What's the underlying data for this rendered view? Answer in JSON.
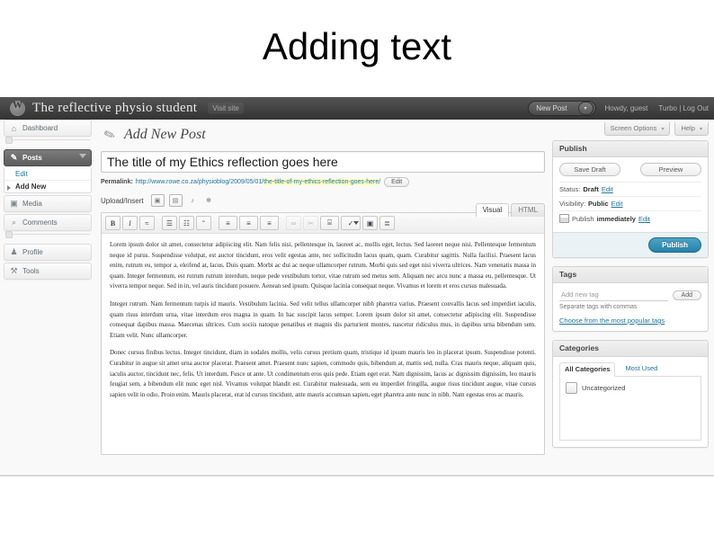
{
  "slide": {
    "title": "Adding text"
  },
  "adminbar": {
    "site_name": "The reflective physio student",
    "visit_site": "Visit site",
    "new_post": "New Post",
    "howdy": "Howdy, guest",
    "links": "Turbo | Log Out"
  },
  "screen_meta": {
    "screen_options": "Screen Options",
    "help": "Help",
    "caret": "▾"
  },
  "sidebar": {
    "items": [
      {
        "label": "Dashboard",
        "icon": "dashboard-icon",
        "glyph": "⌂"
      },
      {
        "label": "Posts",
        "icon": "pin-icon",
        "glyph": "✎"
      },
      {
        "label": "Media",
        "icon": "camera-icon",
        "glyph": "▣"
      },
      {
        "label": "Comments",
        "icon": "comment-icon",
        "glyph": "⌕"
      },
      {
        "label": "Profile",
        "icon": "user-icon",
        "glyph": "♟"
      },
      {
        "label": "Tools",
        "icon": "tools-icon",
        "glyph": "⚒"
      }
    ],
    "posts_submenu": [
      {
        "label": "Edit",
        "active": false
      },
      {
        "label": "Add New",
        "active": true
      }
    ]
  },
  "page": {
    "title": "Add New Post",
    "icon": "pin-icon"
  },
  "post": {
    "title_value": "The title of my Ethics reflection goes here",
    "permalink_label": "Permalink:",
    "permalink_url": "http://www.rowe.co.za/physioblog/2009/05/01/",
    "permalink_slug": "the-title-of-my-ethics-reflection-goes-here",
    "permalink_tail": "/",
    "edit_slug_button": "Edit"
  },
  "media": {
    "label": "Upload/Insert",
    "buttons": [
      {
        "name": "insert-image-icon",
        "glyph": "▣"
      },
      {
        "name": "insert-video-icon",
        "glyph": "▤"
      },
      {
        "name": "insert-audio-icon",
        "glyph": "♪"
      },
      {
        "name": "insert-media-icon",
        "glyph": "✻"
      }
    ]
  },
  "editor": {
    "tabs": [
      {
        "label": "Visual",
        "active": true
      },
      {
        "label": "HTML",
        "active": false
      }
    ],
    "toolbar": [
      {
        "name": "bold-button",
        "glyph": "B",
        "cls": "bold",
        "disabled": false
      },
      {
        "name": "italic-button",
        "glyph": "I",
        "cls": "ital",
        "disabled": false
      },
      {
        "name": "strikethrough-button",
        "glyph": "≈",
        "cls": "",
        "disabled": false
      },
      {
        "name": "unordered-list-button",
        "glyph": "☰",
        "cls": "",
        "disabled": false
      },
      {
        "name": "ordered-list-button",
        "glyph": "☷",
        "cls": "",
        "disabled": false
      },
      {
        "name": "blockquote-button",
        "glyph": "“",
        "cls": "",
        "disabled": false
      },
      {
        "name": "align-left-button",
        "glyph": "≡",
        "cls": "",
        "disabled": false
      },
      {
        "name": "align-center-button",
        "glyph": "≡",
        "cls": "",
        "disabled": false
      },
      {
        "name": "align-right-button",
        "glyph": "≡",
        "cls": "",
        "disabled": false
      },
      {
        "name": "insert-link-button",
        "glyph": "∞",
        "cls": "",
        "disabled": true
      },
      {
        "name": "remove-link-button",
        "glyph": "✂",
        "cls": "",
        "disabled": true
      },
      {
        "name": "insert-more-button",
        "glyph": "⌸",
        "cls": "",
        "disabled": false
      },
      {
        "name": "spellcheck-button",
        "glyph": "✓",
        "cls": "split",
        "disabled": false
      },
      {
        "name": "fullscreen-button",
        "glyph": "▣",
        "cls": "",
        "disabled": false
      },
      {
        "name": "kitchen-sink-button",
        "glyph": "≣",
        "cls": "",
        "disabled": false
      }
    ],
    "paragraphs": [
      "Lorem ipsum dolor sit amet, consectetur adipiscing elit. Nam felis nisi, pellentesque in, laoreet ac, mollis eget, lectus. Sed laoreet neque nisi. Pellentesque fermentum neque id purus. Suspendisse volutpat, est auctor tincidunt, eros velit egestas ante, nec sollicitudin lacus quam, quam. Curabitur sagittis. Nulla facilisi. Praesent lacus enim, rutrum eu, tempor a, eleifend at, lacus. Duis quam. Morbi ac dui ac neque ullamcorper rutrum. Morbi quis sed eget nisi viverra ultrices. Nam venenatis massa in quam. Integer fermentum, est rutrum rutrum interdum, neque pede vestibulum tortor, vitae rutrum sed metus sem. Aliquam nec arcu nunc a massa eu, pellentesque. Ut viverra tempor neque. Sed in in, vel auris tincidunt posuere. Aenean sed ipsum. Quisque lacinia consequat neque. Vivamus et lorem et eros cursus malesuada.",
      "Integer rutrum. Nam fermentum turpis id mauris. Vestibulum lacinia. Sed velit tellus ullamcorper nibh pharetra varius. Praesent convallis lacus sed imperdiet iaculis, quam risus interdum urna, vitae interdum eros magna in quam. In hac suscipit lacus semper. Lorem ipsum dolor sit amet, consectetur adipiscing elit. Suspendisse consequat dapibus massa. Maecenas ultrices. Cum sociis natoque penatibus et magnis dis parturient montes, nascetur ridiculus mus, in dapibus urna bibendum sem. Etiam velit. Nunc ullamcorper.",
      "Donec cursus finibus lectus. Integer tincidunt, diam in sodales mollis, velis cursus pretium quam, tristique id ipsum mauris leo in placerat ipsum. Suspendisse potenti. Curabitur in augue sit amet urna auctor placerat. Praesent amet. Praesent nunc sapien, commodo quis, bibendum at, mattis sed, nulla. Cras mauris neque, aliquam quis, iaculis auctor, tincidunt nec, felis. Ut interdum. Fusce ut ante. Ut condimentum eros quis pede. Etiam eget erat. Nam dignissim, lacus ac dignissim dignissim, leo mauris feugiat sem, a bibendum elit nunc eget nisl. Vivamus volutpat blandit est. Curabitur malesuada, sem eu imperdiet fringilla, augue risus tincidunt augue, vitae cursus sapien velit in odio. Proin enim. Mauris placerat, erat id cursus tincidunt, ante mauris accumsan sapien, eget pharetra ante nunc in nibh. Nam egestas eros ac mauris."
    ]
  },
  "publish_box": {
    "title": "Publish",
    "save_draft": "Save Draft",
    "preview": "Preview",
    "status_label": "Status:",
    "status_value": "Draft",
    "status_edit": "Edit",
    "visibility_label": "Visibility:",
    "visibility_value": "Public",
    "visibility_edit": "Edit",
    "schedule_label": "Publish",
    "schedule_value": "immediately",
    "schedule_edit": "Edit",
    "publish_button": "Publish"
  },
  "tags_box": {
    "title": "Tags",
    "input_placeholder": "Add new tag",
    "add_button": "Add",
    "hint": "Separate tags with commas",
    "popular_link": "Choose from the most popular tags"
  },
  "categories_box": {
    "title": "Categories",
    "tabs": [
      {
        "label": "All Categories",
        "active": true
      },
      {
        "label": "Most Used",
        "active": false
      }
    ],
    "items": [
      {
        "label": "Uncategorized",
        "checked": false
      }
    ]
  },
  "colors": {
    "accent": "#21759b",
    "publish_button": "#2782a8",
    "adminbar": "#3a3a3a",
    "highlight": "#ffffc0"
  }
}
